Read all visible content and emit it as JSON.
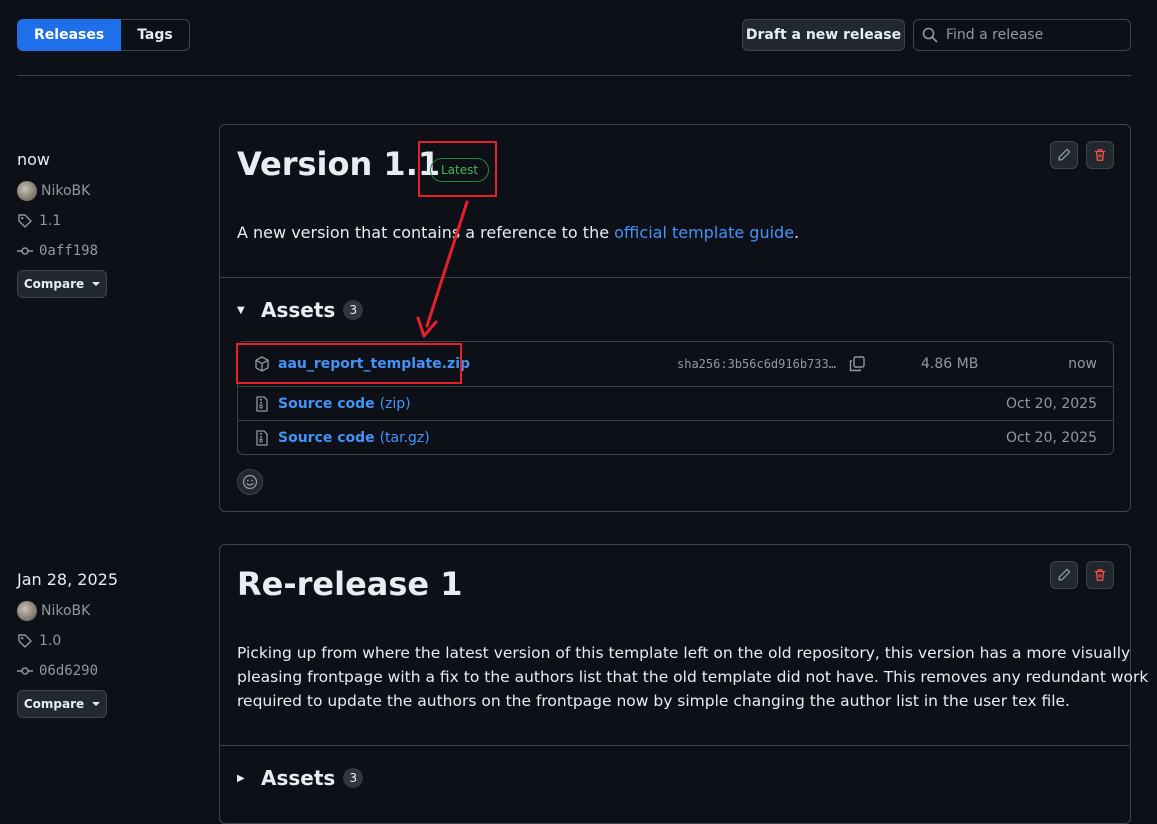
{
  "toolbar": {
    "tabs": [
      {
        "label": "Releases"
      },
      {
        "label": "Tags"
      }
    ],
    "draft_label": "Draft a new release",
    "search_placeholder": "Find a release"
  },
  "releases": [
    {
      "date": "now",
      "author": "NikoBK",
      "tag": "1.1",
      "commit": "0aff198",
      "compare_label": "Compare",
      "title": "Version 1.1",
      "badge": "Latest",
      "desc_prefix": "A new version that contains a reference to the ",
      "desc_link": "official template guide",
      "desc_suffix": ".",
      "assets_label": "Assets",
      "assets_count": "3",
      "assets": [
        {
          "name": "aau_report_template.zip",
          "sha": "sha256:3b56c6d916b733…",
          "size": "4.86 MB",
          "date": "now"
        },
        {
          "name": "Source code",
          "sub": "(zip)",
          "date": "Oct 20, 2025"
        },
        {
          "name": "Source code",
          "sub": "(tar.gz)",
          "date": "Oct 20, 2025"
        }
      ]
    },
    {
      "date": "Jan 28, 2025",
      "author": "NikoBK",
      "tag": "1.0",
      "commit": "06d6290",
      "compare_label": "Compare",
      "title": "Re-release 1",
      "desc_lines": [
        "Picking up from where the latest version of this template left on the old repository, this version has a more visually",
        "pleasing frontpage with a fix to the authors list that the old template did not have. This removes any redundant work",
        "required to update the authors on the frontpage now by simple changing the author list in the user tex file."
      ],
      "assets_label": "Assets",
      "assets_count": "3"
    }
  ],
  "colors": {
    "accent": "#1f6feb",
    "link": "#4493f8",
    "annotation": "#e5202b",
    "latest": "#3fb950"
  },
  "icons": [
    "search-icon",
    "tag-icon",
    "commit-icon",
    "pencil-icon",
    "trash-icon",
    "package-icon",
    "file-zip-icon",
    "copy-icon",
    "smiley-icon"
  ]
}
